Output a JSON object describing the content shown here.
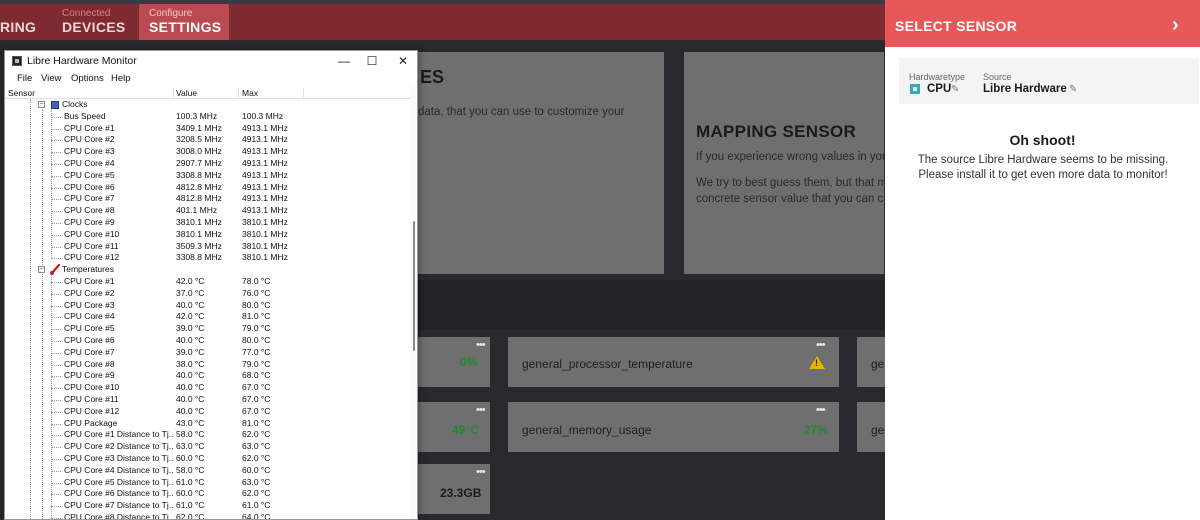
{
  "nav": {
    "monitoring": {
      "big": "RING"
    },
    "devices": {
      "small": "Connected",
      "big": "DEVICES"
    },
    "settings": {
      "small": "Configure",
      "big": "SETTINGS"
    }
  },
  "cards": {
    "devices_title": "ES",
    "devices_text": "data, that you can use to customize your",
    "mapping_title": "MAPPING SENSOR",
    "mapping_text1": "If you experience wrong values in your",
    "mapping_text2": "We try to best guess them, but that mi",
    "mapping_text3": "concrete sensor value that you can cho"
  },
  "tiles": [
    {
      "value": "0%",
      "label": ""
    },
    {
      "value": "",
      "label": "general_processor_temperature"
    },
    {
      "value": "49°C",
      "label": ""
    },
    {
      "value": "27%",
      "label": "general_memory_usage"
    },
    {
      "value": "23.3GB",
      "label": ""
    },
    {
      "label": "ger"
    },
    {
      "label": "ger"
    }
  ],
  "tile_dots": "•••",
  "lhm": {
    "title": "Libre Hardware Monitor",
    "win_minimize": "—",
    "win_maximize": "☐",
    "win_close": "✕",
    "menu": [
      "File",
      "View",
      "Options",
      "Help"
    ],
    "columns": {
      "sensor": "Sensor",
      "value": "Value",
      "max": "Max"
    },
    "clocks_label": "Clocks",
    "clocks": [
      {
        "name": "Bus Speed",
        "value": "100.3 MHz",
        "max": "100.3 MHz"
      },
      {
        "name": "CPU Core #1",
        "value": "3409.1 MHz",
        "max": "4913.1 MHz"
      },
      {
        "name": "CPU Core #2",
        "value": "3208.5 MHz",
        "max": "4913.1 MHz"
      },
      {
        "name": "CPU Core #3",
        "value": "3008.0 MHz",
        "max": "4913.1 MHz"
      },
      {
        "name": "CPU Core #4",
        "value": "2907.7 MHz",
        "max": "4913.1 MHz"
      },
      {
        "name": "CPU Core #5",
        "value": "3308.8 MHz",
        "max": "4913.1 MHz"
      },
      {
        "name": "CPU Core #6",
        "value": "4812.8 MHz",
        "max": "4913.1 MHz"
      },
      {
        "name": "CPU Core #7",
        "value": "4812.8 MHz",
        "max": "4913.1 MHz"
      },
      {
        "name": "CPU Core #8",
        "value": "401.1 MHz",
        "max": "4913.1 MHz"
      },
      {
        "name": "CPU Core #9",
        "value": "3810.1 MHz",
        "max": "3810.1 MHz"
      },
      {
        "name": "CPU Core #10",
        "value": "3810.1 MHz",
        "max": "3810.1 MHz"
      },
      {
        "name": "CPU Core #11",
        "value": "3509.3 MHz",
        "max": "3810.1 MHz"
      },
      {
        "name": "CPU Core #12",
        "value": "3308.8 MHz",
        "max": "3810.1 MHz"
      }
    ],
    "temps_label": "Temperatures",
    "temps": [
      {
        "name": "CPU Core #1",
        "value": "42.0 °C",
        "max": "78.0 °C"
      },
      {
        "name": "CPU Core #2",
        "value": "37.0 °C",
        "max": "76.0 °C"
      },
      {
        "name": "CPU Core #3",
        "value": "40.0 °C",
        "max": "80.0 °C"
      },
      {
        "name": "CPU Core #4",
        "value": "42.0 °C",
        "max": "81.0 °C"
      },
      {
        "name": "CPU Core #5",
        "value": "39.0 °C",
        "max": "79.0 °C"
      },
      {
        "name": "CPU Core #6",
        "value": "40.0 °C",
        "max": "80.0 °C"
      },
      {
        "name": "CPU Core #7",
        "value": "39.0 °C",
        "max": "77.0 °C"
      },
      {
        "name": "CPU Core #8",
        "value": "38.0 °C",
        "max": "79.0 °C"
      },
      {
        "name": "CPU Core #9",
        "value": "40.0 °C",
        "max": "68.0 °C"
      },
      {
        "name": "CPU Core #10",
        "value": "40.0 °C",
        "max": "67.0 °C"
      },
      {
        "name": "CPU Core #11",
        "value": "40.0 °C",
        "max": "67.0 °C"
      },
      {
        "name": "CPU Core #12",
        "value": "40.0 °C",
        "max": "67.0 °C"
      },
      {
        "name": "CPU Package",
        "value": "43.0 °C",
        "max": "81.0 °C"
      },
      {
        "name": "CPU Core #1 Distance to Tj...",
        "value": "58.0 °C",
        "max": "62.0 °C"
      },
      {
        "name": "CPU Core #2 Distance to Tj...",
        "value": "63.0 °C",
        "max": "63.0 °C"
      },
      {
        "name": "CPU Core #3 Distance to Tj...",
        "value": "60.0 °C",
        "max": "62.0 °C"
      },
      {
        "name": "CPU Core #4 Distance to Tj...",
        "value": "58.0 °C",
        "max": "60.0 °C"
      },
      {
        "name": "CPU Core #5 Distance to Tj...",
        "value": "61.0 °C",
        "max": "63.0 °C"
      },
      {
        "name": "CPU Core #6 Distance to Tj...",
        "value": "60.0 °C",
        "max": "62.0 °C"
      },
      {
        "name": "CPU Core #7 Distance to Tj...",
        "value": "61.0 °C",
        "max": "61.0 °C"
      },
      {
        "name": "CPU Core #8 Distance to Tj...",
        "value": "62.0 °C",
        "max": "64.0 °C"
      }
    ]
  },
  "panel": {
    "title": "SELECT SENSOR",
    "next_glyph": "›",
    "hardware_label": "Hardwaretype",
    "hardware_value": "CPU",
    "source_label": "Source",
    "source_value": "Libre Hardware",
    "edit_glyph": "✎",
    "error_title": "Oh shoot!",
    "error_message": "The source Libre Hardware seems to be missing. Please install it to get even more data to monitor!"
  },
  "colors": {
    "accent": "#e8585b",
    "topbar": "#7e2a30",
    "tab_active": "#b94a50",
    "ok_green": "#1f8a2e",
    "warning": "#e6b400"
  }
}
